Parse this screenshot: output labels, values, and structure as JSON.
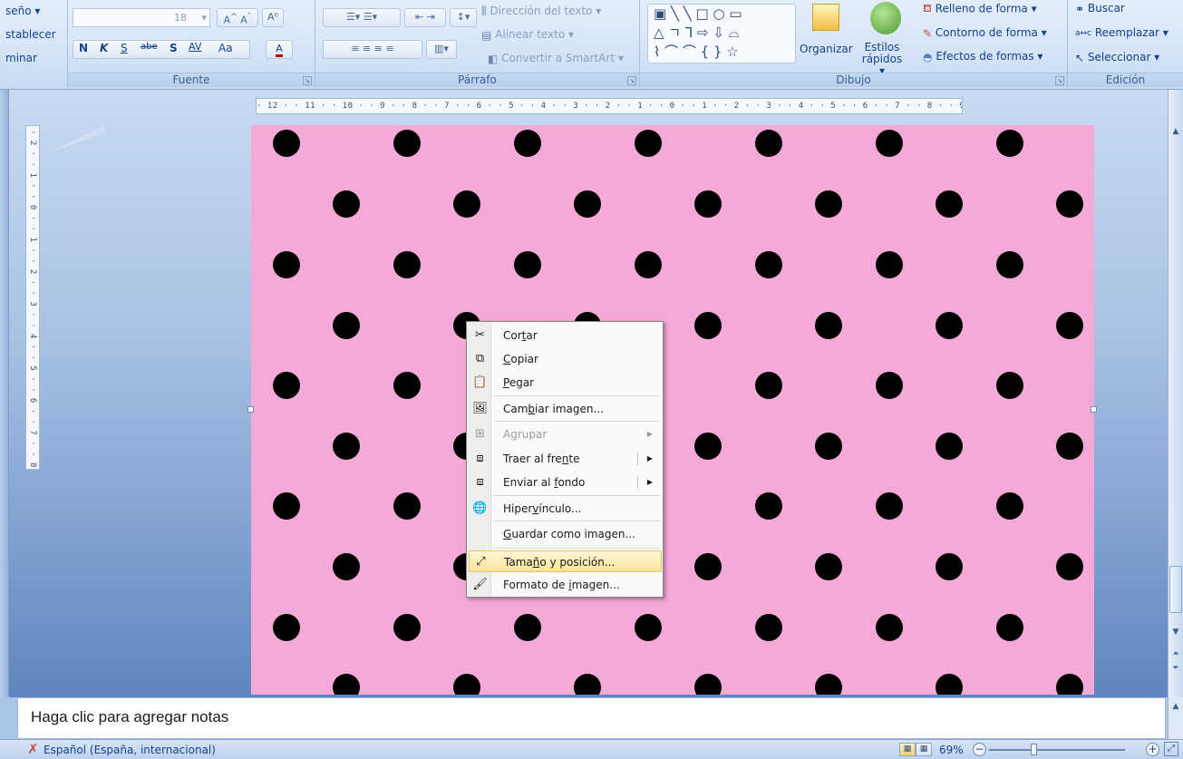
{
  "ribbon": {
    "left_group_items": [
      "seño ▾",
      "stablecer",
      "minar"
    ],
    "font": {
      "font_name": "",
      "font_size": "18",
      "bold": "N",
      "italic": "K",
      "underline": "S",
      "strike": "abe",
      "shadow": "S",
      "spacing": "AV",
      "case": "Aa",
      "color": "A",
      "label": "Fuente"
    },
    "paragraph": {
      "text_direction": "Dirección del texto ▾",
      "align_text": "Alinear texto ▾",
      "smartart": "Convertir a SmartArt ▾",
      "label": "Párrafo"
    },
    "drawing": {
      "organize": "Organizar",
      "quick_styles": "Estilos rápidos ▾",
      "shape_fill": "Relleno de forma ▾",
      "shape_outline": "Contorno de forma ▾",
      "shape_effects": "Efectos de formas ▾",
      "label": "Dibujo"
    },
    "editing": {
      "find": "Buscar",
      "replace": "Reemplazar ▾",
      "select": "Seleccionar ▾",
      "label": "Edición"
    }
  },
  "ruler": {
    "horizontal": "· 12 · · 11 · · 10 · · 9 · · 8 · · 7 · · 6 · · 5 · · 4 · · 3 · · 2 · · 1 · · 0 · · 1 · · 2 · · 3 · · 4 · · 5 · · 6 · · 7 · · 8 · · 9 · · 10 · · 11 · · 12 ·",
    "vertical": "· 2 · · 1 · · 0 · · 1 · · 2 · · 3 · · 4 · · 5 · · 6 · · 7 · · 8 · · 9 ·"
  },
  "slide": {
    "background_color": "#f5a9d6",
    "dot_color": "#000000"
  },
  "context_menu": {
    "items": [
      {
        "pre": "Cor",
        "u": "t",
        "post": "ar",
        "icon": "scissors-icon",
        "glyph": "✂",
        "enabled": true
      },
      {
        "pre": "",
        "u": "C",
        "post": "opiar",
        "icon": "copy-icon",
        "glyph": "⧉",
        "enabled": true
      },
      {
        "pre": "",
        "u": "P",
        "post": "egar",
        "icon": "paste-icon",
        "glyph": "📋",
        "enabled": true
      },
      {
        "pre": "Cam",
        "u": "b",
        "post": "iar imagen...",
        "icon": "change-picture-icon",
        "glyph": "🖼",
        "enabled": true
      },
      {
        "pre": "A",
        "u": "g",
        "post": "rupar",
        "icon": "group-icon",
        "glyph": "⊞",
        "enabled": false,
        "submenu": true
      },
      {
        "pre": "Traer al fre",
        "u": "n",
        "post": "te",
        "icon": "bring-to-front-icon",
        "glyph": "⧈",
        "enabled": true,
        "submenu": true
      },
      {
        "pre": "Enviar al ",
        "u": "f",
        "post": "ondo",
        "icon": "send-to-back-icon",
        "glyph": "⧈",
        "enabled": true,
        "submenu": true
      },
      {
        "pre": "Hiper",
        "u": "v",
        "post": "ínculo...",
        "icon": "hyperlink-icon",
        "glyph": "🌐",
        "enabled": true
      },
      {
        "pre": "",
        "u": "G",
        "post": "uardar como imagen...",
        "icon": "",
        "glyph": "",
        "enabled": true
      },
      {
        "pre": "Tama",
        "u": "ñ",
        "post": "o y posición...",
        "icon": "size-position-icon",
        "glyph": "⤢",
        "enabled": true,
        "highlighted": true
      },
      {
        "pre": "Formato de ",
        "u": "i",
        "post": "magen...",
        "icon": "format-picture-icon",
        "glyph": "🖌",
        "enabled": true
      }
    ]
  },
  "notes": {
    "placeholder": "Haga clic para agregar notas"
  },
  "status": {
    "language": "Español (España, internacional)",
    "zoom": "69%",
    "zoom_level": 0.69
  }
}
